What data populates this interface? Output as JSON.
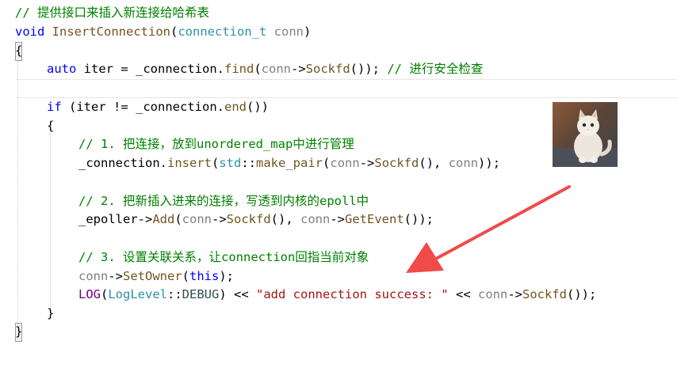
{
  "code": {
    "comment_title": "// 提供接口来插入新连接给哈希表",
    "kw_void": "void",
    "fn_name": "InsertConnection",
    "open_paren": "(",
    "param_type": "connection_t",
    "param_name": "conn",
    "close_paren": ")",
    "brace_open": "{",
    "brace_close": "}",
    "kw_auto": "auto",
    "iter": "iter",
    "eq": " = ",
    "connection": "_connection",
    "dot": ".",
    "find": "find",
    "lp": "(",
    "conn": "conn",
    "arrow": "->",
    "sockfd": "Sockfd",
    "empty_parens": "()",
    "rp_semi": ");",
    "comment_check": " // 进行安全检查",
    "kw_if": "if",
    "space_lp": " (",
    "neq": " != ",
    "end": "end",
    "rp": ")",
    "comment_1": "// 1. 把连接，放到unordered_map中进行管理",
    "insert": "insert",
    "std": "std",
    "scope": "::",
    "make_pair": "make_pair",
    "comma": ", ",
    "rpp_semi": "));",
    "comment_2": "// 2. 把新插入进来的连接，写透到内核的epoll中",
    "epoller": "_epoller",
    "add": "Add",
    "geteve": "GetEvent",
    "comment_3": "// 3. 设置关联关系，让connection回指当前对象",
    "setowner": "SetOwner",
    "kw_this": "this",
    "log": "LOG",
    "loglevel": "LogLevel",
    "debug": "DEBUG",
    "shift": " << ",
    "str_success": "\"add connection success: \"",
    "final": "());"
  },
  "colors": {
    "comment": "#008000",
    "keyword": "#0000ff",
    "type": "#2b91af",
    "function": "#74531f",
    "param": "#808080",
    "string": "#a31515",
    "macro": "#6f008a",
    "arrow_annotation": "#f04a4a"
  },
  "image": {
    "description_icon": "cat-photo"
  }
}
